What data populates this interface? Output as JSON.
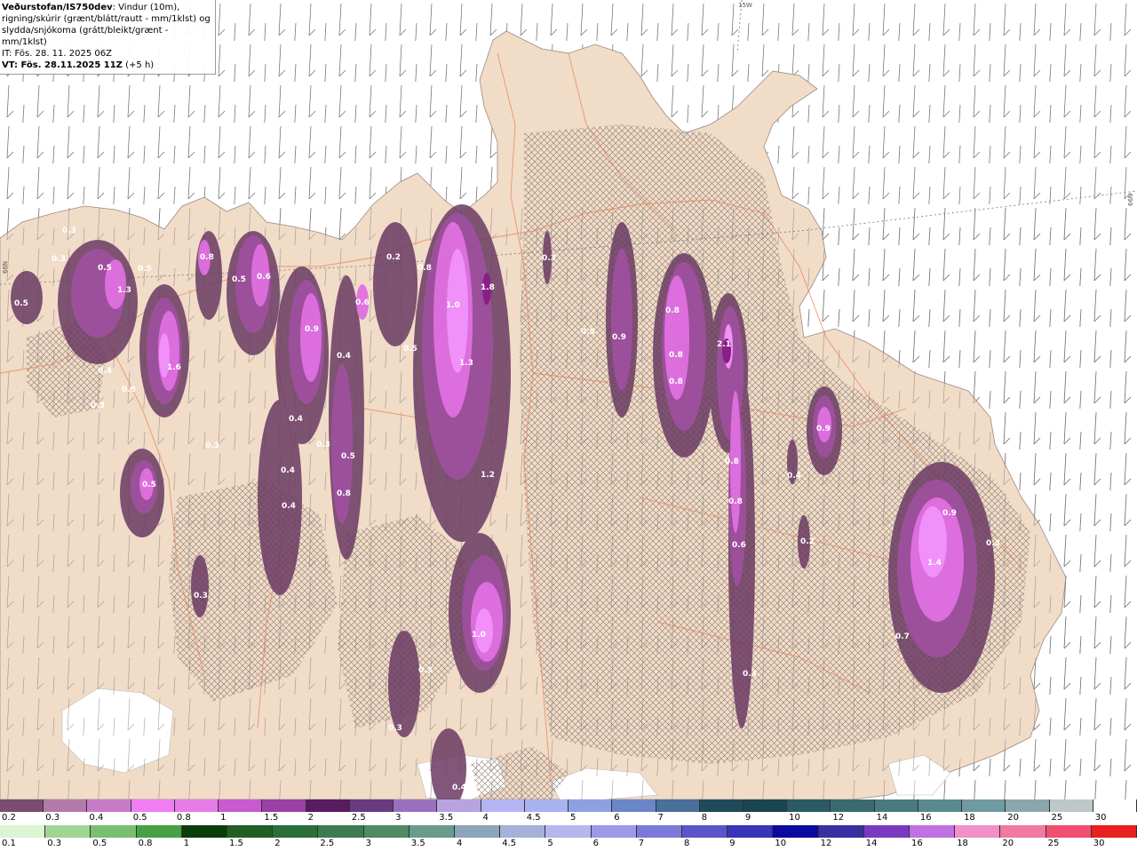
{
  "header": {
    "source": "Veðurstofan/IS750dev",
    "line1_rest": ": Vindur (10m),",
    "line2": "rigning/skúrir (grænt/blátt/rautt - mm/1klst) og",
    "line3": "slydda/snjókoma (grátt/bleikt/grænt - mm/1klst)",
    "init_time": "IT: Fös. 28. 11. 2025 06Z",
    "valid_time": "VT: Fös. 28.11.2025 11Z",
    "lead": " (+5 h)"
  },
  "grid_labels": {
    "top": "15W",
    "right": "66N",
    "left": "66N"
  },
  "colors": {
    "land": "#f1dcc8",
    "sea": "#ffffff",
    "roads": "#e8825a",
    "wind_barbs": "#777777",
    "hatch": "#8a7a70",
    "precip_dark": "#6b3a63",
    "precip_mid": "#a050a0",
    "precip_light": "#e070e0",
    "precip_bright": "#f090f8"
  },
  "precip_values": [
    "0.3",
    "0.3",
    "0.5",
    "0.5",
    "1.3",
    "0.5",
    "0.4",
    "0.6",
    "1.6",
    "0.3",
    "0.5",
    "0.8",
    "0.5",
    "0.6",
    "0.9",
    "0.4",
    "0.4",
    "0.4",
    "0.4",
    "0.3",
    "0.3",
    "0.5",
    "0.8",
    "0.3",
    "0.6",
    "0.2",
    "0.8",
    "1.0",
    "0.5",
    "1.8",
    "1.3",
    "1.2",
    "0.3",
    "0.5",
    "0.9",
    "0.8",
    "0.8",
    "0.8",
    "2.1",
    "0.8",
    "0.8",
    "0.6",
    "0.9",
    "0.4",
    "0.2",
    "0.9",
    "1.4",
    "0.3",
    "0.7",
    "1.0",
    "0.3",
    "0.3",
    "0.3",
    "0.4"
  ],
  "legend_rain_snow": {
    "values": [
      "0.2",
      "0.3",
      "0.4",
      "0.5",
      "0.8",
      "1",
      "1.5",
      "2",
      "2.5",
      "3",
      "3.5",
      "4",
      "4.5",
      "5",
      "6",
      "7",
      "8",
      "9",
      "10",
      "12",
      "14",
      "16",
      "18",
      "20",
      "25",
      "30"
    ],
    "colors": [
      "#7a4d6e",
      "#b27aa8",
      "#c77bc9",
      "#f07ef2",
      "#e57ce8",
      "#c95ad0",
      "#9b3ea6",
      "#5a1a60",
      "#6a3a80",
      "#9b6fbf",
      "#b8a2e0",
      "#b4b4f5",
      "#a9b3ef",
      "#8fa0e2",
      "#6a85c8",
      "#4a6f9a",
      "#204a5a",
      "#1a4450",
      "#2a5a64",
      "#3a6a70",
      "#4a7a80",
      "#5a8a90",
      "#6e9aa0",
      "#8aa8ab",
      "#bcc8ca",
      "#ffffff"
    ]
  },
  "legend_rain": {
    "values": [
      "0.1",
      "0.3",
      "0.5",
      "0.8",
      "1",
      "1.5",
      "2",
      "2.5",
      "3",
      "3.5",
      "4",
      "4.5",
      "5",
      "6",
      "7",
      "8",
      "9",
      "10",
      "12",
      "14",
      "16",
      "18",
      "20",
      "25",
      "30"
    ],
    "colors": [
      "#dbf5d5",
      "#9fd593",
      "#78c070",
      "#48a046",
      "#0b3d0b",
      "#205e22",
      "#2a6e3a",
      "#3c7c50",
      "#4e8a66",
      "#6a9a8a",
      "#8aa6b8",
      "#a6b0d8",
      "#b4b8ee",
      "#9a9ae8",
      "#7b7ad8",
      "#5a56c8",
      "#3a34b8",
      "#0a0aa0",
      "#3a2ea0",
      "#7a3ac0",
      "#c070e0",
      "#f090c8",
      "#f07aa0",
      "#f05070",
      "#e82020"
    ]
  }
}
